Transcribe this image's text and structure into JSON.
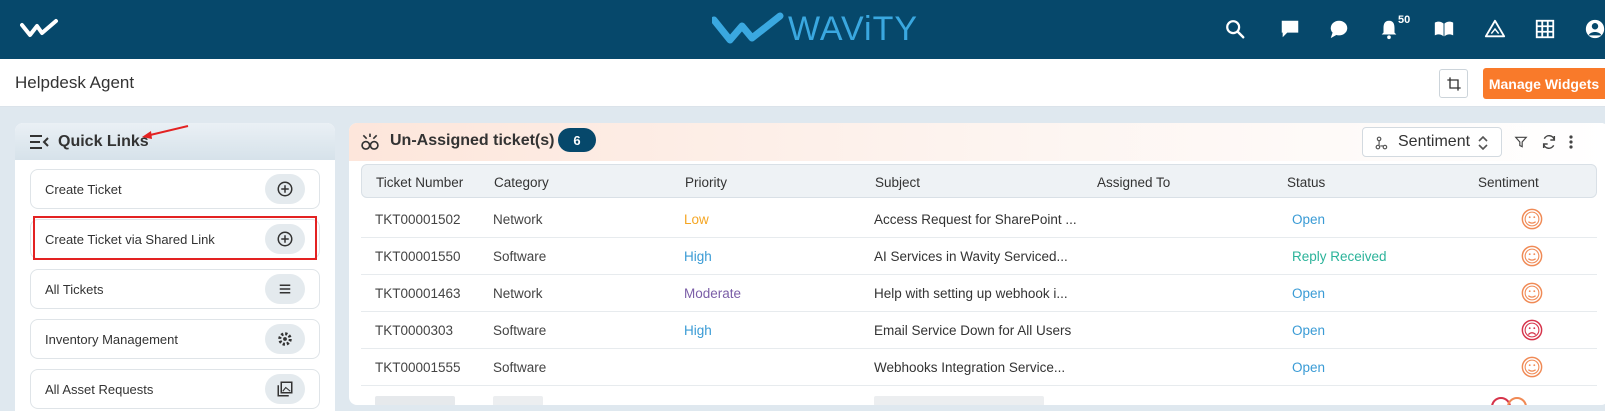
{
  "brand": {
    "name": "WAViTY"
  },
  "topbar": {
    "notification_count": "50"
  },
  "page": {
    "title": "Helpdesk Agent",
    "manage_widgets_label": "Manage Widgets"
  },
  "quick_links": {
    "title": "Quick Links",
    "items": [
      {
        "label": "Create Ticket",
        "icon": "plus-circle-icon"
      },
      {
        "label": "Create Ticket via Shared Link",
        "icon": "plus-circle-icon"
      },
      {
        "label": "All Tickets",
        "icon": "menu-lines-icon"
      },
      {
        "label": "Inventory Management",
        "icon": "gear-icon"
      },
      {
        "label": "All Asset Requests",
        "icon": "gallery-icon"
      }
    ]
  },
  "tickets": {
    "title": "Un-Assigned ticket(s)",
    "count": "6",
    "sort_select": "Sentiment",
    "columns": [
      "Ticket Number",
      "Category",
      "Priority",
      "Subject",
      "Assigned To",
      "Status",
      "Sentiment"
    ],
    "rows": [
      {
        "number": "TKT00001502",
        "category": "Network",
        "priority": "Low",
        "subject": "Access Request for SharePoint ...",
        "assigned": "",
        "status": "Open",
        "sentiment": "neutral"
      },
      {
        "number": "TKT00001550",
        "category": "Software",
        "priority": "High",
        "subject": "AI Services in Wavity Serviced...",
        "assigned": "",
        "status": "Reply Received",
        "sentiment": "neutral"
      },
      {
        "number": "TKT00001463",
        "category": "Network",
        "priority": "Moderate",
        "subject": "Help with setting up webhook i...",
        "assigned": "",
        "status": "Open",
        "sentiment": "neutral"
      },
      {
        "number": "TKT0000303",
        "category": "Software",
        "priority": "High",
        "subject": "Email Service Down for All Users",
        "assigned": "",
        "status": "Open",
        "sentiment": "negative"
      },
      {
        "number": "TKT00001555",
        "category": "Software",
        "priority": "",
        "subject": "Webhooks Integration Service...",
        "assigned": "",
        "status": "Open",
        "sentiment": "neutral"
      }
    ]
  },
  "colors": {
    "topbar": "#06486b",
    "accent_orange": "#f97a2a",
    "priority_low": "#f5a623",
    "priority_high": "#3a9bd5",
    "priority_moderate": "#7b5ea7",
    "status_open": "#3a9bd5",
    "status_reply": "#2bb39a",
    "sentiment_neutral": "#f08a55",
    "sentiment_negative": "#d6334a"
  }
}
